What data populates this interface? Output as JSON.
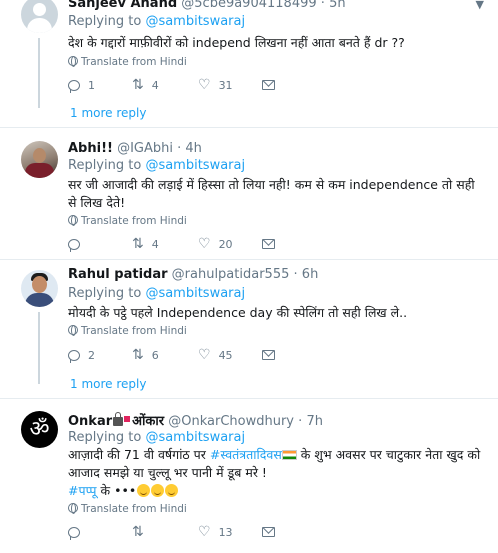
{
  "tweets": [
    {
      "name": "Sanjeev Anand",
      "handle": "@5cbe9a904118499",
      "time": "5h",
      "replying_label": "Replying to",
      "replying_to": "@sambitswaraj",
      "text": "देश के गद्दारों  माफ़ीवीरों  को independ लिखना नहीं आता बनते हैं dr ??",
      "translate": "Translate from Hindi",
      "replies": "1",
      "retweets": "4",
      "likes": "31",
      "more_replies": "1 more reply"
    },
    {
      "name": "Abhi!!",
      "handle": "@IGAbhi",
      "time": "4h",
      "replying_label": "Replying to",
      "replying_to": "@sambitswaraj",
      "text": "सर जी आजादी की लड़ाई में हिस्सा तो लिया नही! कम से कम independence तो सही से लिख देते!",
      "translate": "Translate from Hindi",
      "replies": "",
      "retweets": "4",
      "likes": "20"
    },
    {
      "name": "Rahul patidar",
      "handle": "@rahulpatidar555",
      "time": "6h",
      "replying_label": "Replying to",
      "replying_to": "@sambitswaraj",
      "text": "मोयदी के पट्ठे पहले Independence day की स्पेलिंग तो सही लिख ले..",
      "translate": "Translate from Hindi",
      "replies": "2",
      "retweets": "6",
      "likes": "45",
      "more_replies": "1 more reply"
    },
    {
      "name_prefix": "Onkar",
      "name_suffix": "ओंकार",
      "handle": "@OnkarChowdhury",
      "time": "7h",
      "replying_label": "Replying to",
      "replying_to": "@sambitswaraj",
      "text_part1": "आज़ादी की 71 वी वर्षगांठ पर ",
      "hashtag1": "#स्वतंत्रतादिवस",
      "text_part2": " के शुभ अवसर पर चाटुकार नेता खुद को आजाद समझे या चुल्लू भर पानी में डूब मरे !",
      "hashtag2": "#पप्पू",
      "text_part3": " के •••",
      "translate": "Translate from Hindi",
      "replies": "",
      "retweets": "",
      "likes": "13"
    }
  ],
  "icons": {
    "caret": "chevron-down-icon",
    "reply": "reply-icon",
    "retweet": "retweet-icon",
    "like": "heart-icon",
    "dm": "envelope-icon",
    "translate": "globe-icon"
  },
  "colors": {
    "accent": "#1da1f2",
    "muted": "#657786",
    "text": "#14171a",
    "border": "#e6ecf0"
  }
}
